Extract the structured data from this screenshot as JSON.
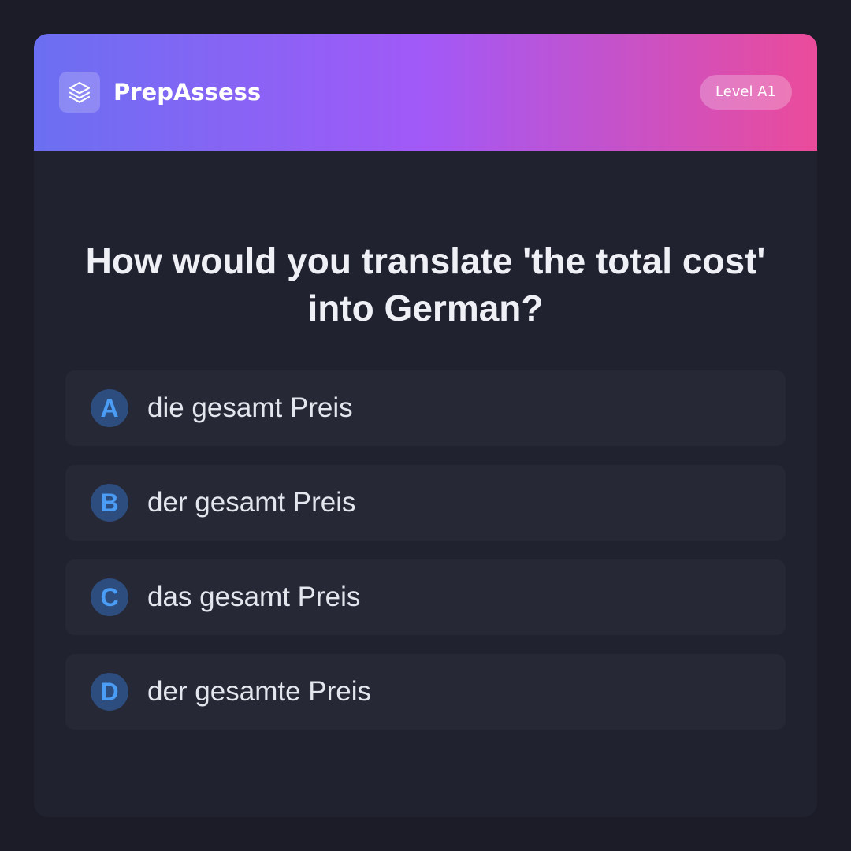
{
  "header": {
    "brand": "PrepAssess",
    "logo_icon": "layers-icon",
    "level": "Level A1"
  },
  "question": {
    "text": "How would you translate 'the total cost' into German?"
  },
  "options": [
    {
      "letter": "A",
      "text": "die gesamt Preis"
    },
    {
      "letter": "B",
      "text": "der gesamt Preis"
    },
    {
      "letter": "C",
      "text": "das gesamt Preis"
    },
    {
      "letter": "D",
      "text": "der gesamte Preis"
    }
  ],
  "colors": {
    "background": "#1b1c28",
    "card": "#202230",
    "option": "#262836",
    "badge_bg": "#2c4d7e",
    "badge_text": "#4b9cf5",
    "gradient_start": "#6b6ff2",
    "gradient_mid": "#a259f7",
    "gradient_end": "#eb4b9a"
  }
}
